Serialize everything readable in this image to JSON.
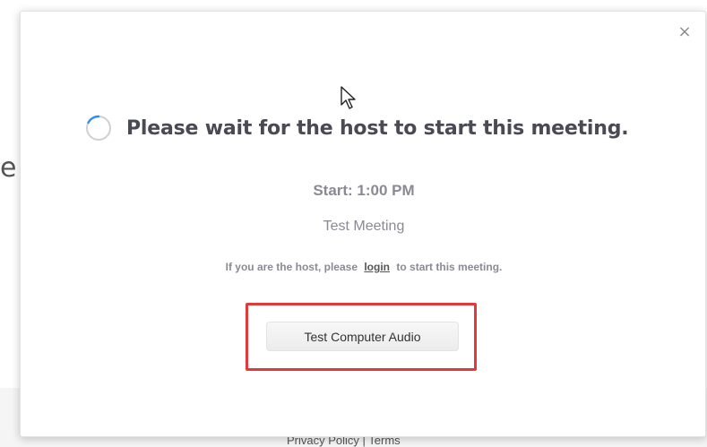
{
  "background": {
    "partial_letter": "e",
    "footer_links": "Privacy Policy | Terms"
  },
  "dialog": {
    "close_glyph": "×",
    "headline": "Please wait for the host to start this meeting.",
    "start_time": "Start: 1:00 PM",
    "meeting_name": "Test Meeting",
    "host_prefix": "If you are the host, please",
    "login_label": "login",
    "host_suffix": "to start this meeting.",
    "audio_button_label": "Test Computer Audio"
  },
  "colors": {
    "highlight": "#e03a3a",
    "spinner": "#2d8cff",
    "headline": "#4a4a55",
    "muted_text": "#8a8a95"
  },
  "icons": {
    "close": "close-icon",
    "spinner": "loading-spinner-icon",
    "cursor": "mouse-pointer-icon"
  }
}
